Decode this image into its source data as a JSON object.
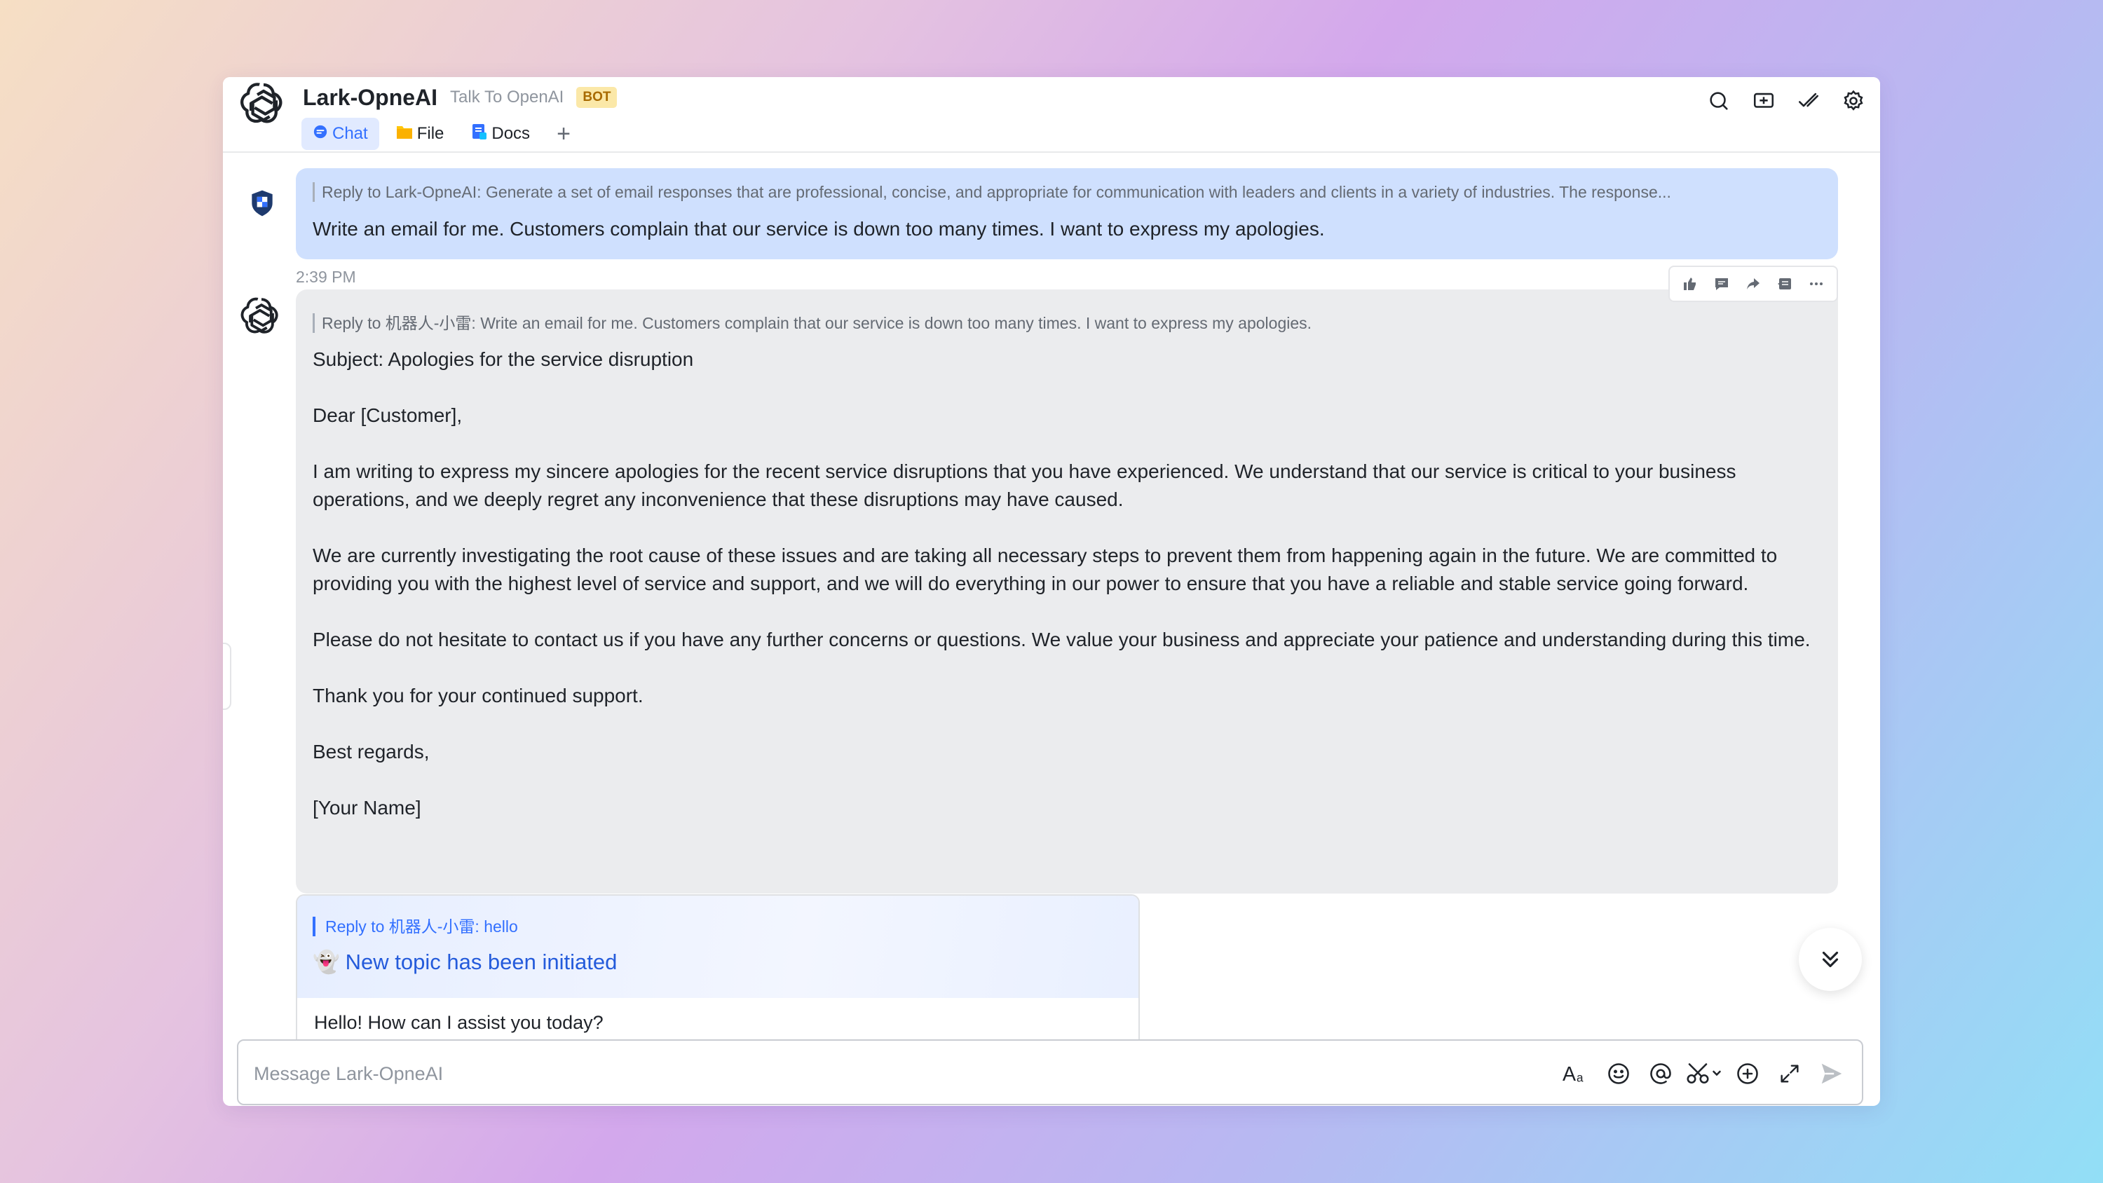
{
  "header": {
    "title": "Lark-OpneAI",
    "subtitle": "Talk To OpenAI",
    "badge": "BOT",
    "tabs": [
      {
        "label": "Chat",
        "icon": "chat-bubble-icon",
        "active": true
      },
      {
        "label": "File",
        "icon": "folder-icon",
        "active": false
      },
      {
        "label": "Docs",
        "icon": "docs-icon",
        "active": false
      }
    ],
    "add_tab": "+",
    "tools": [
      "search-icon",
      "new-chat-icon",
      "check-done-icon",
      "settings-icon"
    ]
  },
  "messages": {
    "user": {
      "quote": "Reply to Lark-OpneAI:  Generate a set of email responses that are professional, concise, and appropriate for communication with leaders and clients in a variety of industries. The response...",
      "text": "Write an email for me. Customers complain that our service is down too many times. I want to express my apologies."
    },
    "timestamp": "2:39 PM",
    "bot": {
      "quote": "Reply to 机器人-小雷:  Write an email for me. Customers complain that our service is down too many times. I want to express my apologies.",
      "paragraphs": [
        "Subject: Apologies for the service disruption",
        "Dear [Customer],",
        "I am writing to express my sincere apologies for the recent service disruptions that you have experienced. We understand that our service is critical to your business operations, and we deeply regret any inconvenience that these disruptions may have caused.",
        "We are currently investigating the root cause of these issues and are taking all necessary steps to prevent them from happening again in the future. We are committed to providing you with the highest level of service and support, and we will do everything in our power to ensure that you have a reliable and stable service going forward.",
        "Please do not hesitate to contact us if you have any further concerns or questions. We value your business and appreciate your patience and understanding during this time.",
        "Thank you for your continued support.",
        "Best regards,",
        "[Your Name]"
      ]
    },
    "card": {
      "quote": "Reply to 机器人-小雷:  hello",
      "emoji": "👻",
      "title": "New topic has been initiated",
      "body": "Hello! How can I assist you today?"
    }
  },
  "message_actions": [
    "thumbs-up-icon",
    "comment-icon",
    "forward-icon",
    "quote-reply-icon",
    "more-icon"
  ],
  "input": {
    "placeholder": "Message Lark-OpneAI",
    "value": "",
    "tools": [
      "text-format-icon",
      "emoji-icon",
      "mention-icon",
      "screenshot-scissors-icon",
      "add-circle-icon",
      "expand-icon",
      "send-icon"
    ]
  },
  "colors": {
    "accent": "#3370ff",
    "user_bubble": "#cfe0fe",
    "bot_bubble": "#ebecee",
    "badge_bg": "#fbe8a8"
  }
}
